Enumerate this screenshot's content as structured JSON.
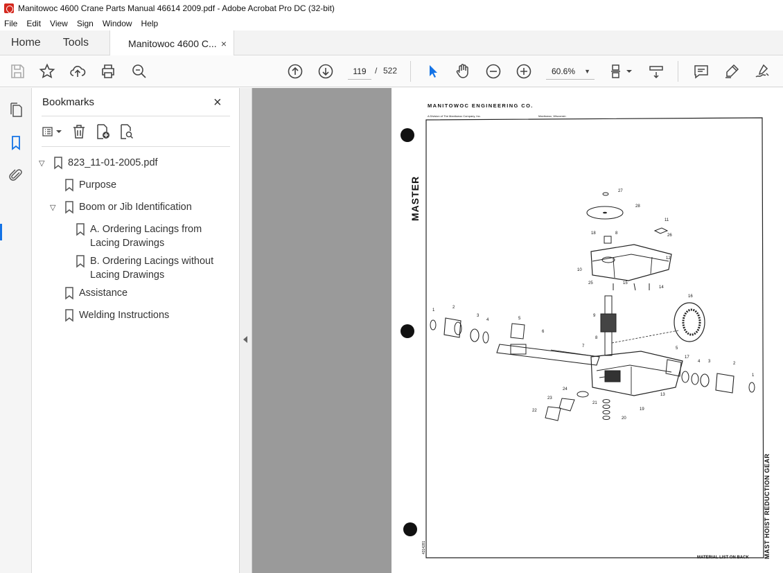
{
  "window": {
    "title": "Manitowoc 4600 Crane Parts Manual 46614 2009.pdf - Adobe Acrobat Pro DC (32-bit)"
  },
  "menu": [
    "File",
    "Edit",
    "View",
    "Sign",
    "Window",
    "Help"
  ],
  "tabs": {
    "home": "Home",
    "tools": "Tools",
    "document": "Manitowoc 4600 C...",
    "close": "×"
  },
  "toolbar": {
    "page_current": "119",
    "page_sep": "/",
    "page_total": "522",
    "zoom": "60.6%",
    "icons": [
      "save-icon",
      "star-icon",
      "upload-icon",
      "print-icon",
      "zoom-search-icon",
      "page-up-icon",
      "page-down-icon",
      "select-pointer-icon",
      "hand-icon",
      "zoom-out-icon",
      "zoom-in-icon",
      "fit-page-icon",
      "scroll-mode-icon",
      "comment-icon",
      "highlight-icon",
      "sign-icon"
    ]
  },
  "colors": {
    "accent": "#1473e6",
    "document_bg": "#9a9a9a"
  },
  "bookmarks": {
    "title": "Bookmarks",
    "close": "×",
    "items": [
      {
        "label": "823_11-01-2005.pdf",
        "expanded": true
      },
      {
        "label": "Purpose"
      },
      {
        "label": "Boom or Jib Identification",
        "expanded": true
      },
      {
        "label": "A. Ordering Lacings from Lacing Drawings"
      },
      {
        "label": "B. Ordering Lacings without Lacing Drawings"
      },
      {
        "label": "Assistance"
      },
      {
        "label": "Welding Instructions"
      }
    ]
  },
  "pdf_page": {
    "company": "MANITOWOC ENGINEERING CO.",
    "division": "A Division of The Manitowoc Company, Inc.",
    "location": "Manitowoc, Wisconsin",
    "side_label": "MASTER",
    "drawing_title": "MAST HOIST REDUCTION GEAR",
    "footer": "MATERIAL LIST ON BACK",
    "doc_number": "4314281",
    "callouts": [
      "27",
      "28",
      "11",
      "18",
      "8",
      "26",
      "12",
      "10",
      "25",
      "15",
      "14",
      "16",
      "9",
      "1",
      "2",
      "3",
      "4",
      "5",
      "6",
      "7",
      "8",
      "5",
      "17",
      "4",
      "3",
      "2",
      "1",
      "24",
      "13",
      "23",
      "21",
      "19",
      "22",
      "20"
    ]
  }
}
